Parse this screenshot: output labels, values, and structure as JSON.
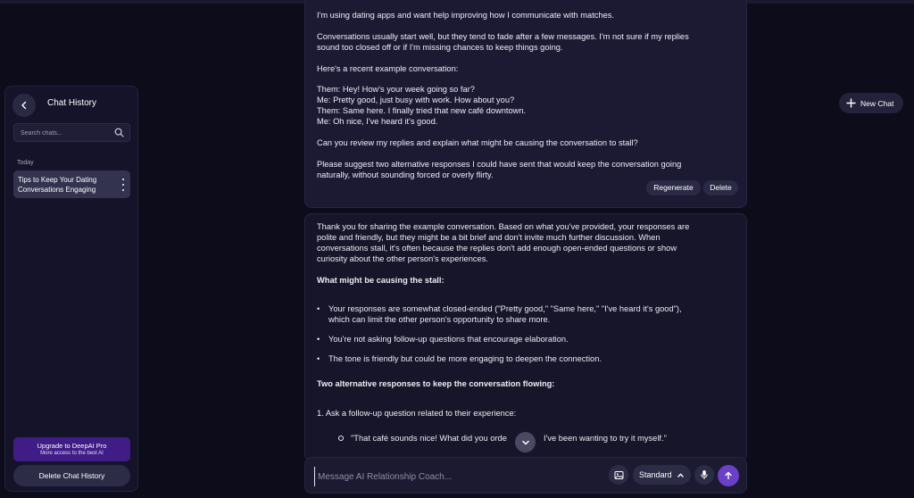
{
  "sidebar": {
    "title": "Chat History",
    "search_placeholder": "Search chats...",
    "group_label": "Today",
    "items": [
      {
        "label": "Tips to Keep Your Dating Conversations Engaging"
      }
    ],
    "upgrade_title": "Upgrade to DeepAI Pro",
    "upgrade_subtitle": "More access to the best AI",
    "delete_label": "Delete Chat History"
  },
  "header": {
    "new_chat_label": "New Chat"
  },
  "user_message": {
    "p1": "I'm using dating apps and want help improving how I communicate with matches.",
    "p2_l1": "Conversations usually start well, but they tend to fade after a few messages. I'm not sure if my replies",
    "p2_l2": "sound too closed off or if I'm missing chances to keep things going.",
    "p3": "Here's a recent example conversation:",
    "convo": [
      "Them: Hey! How's your week going so far?",
      "Me: Pretty good, just busy with work. How about you?",
      "Them: Same here. I finally tried that new café downtown.",
      "Me: Oh nice, I've heard it's good."
    ],
    "p4": "Can you review my replies and explain what might be causing the conversation to stall?",
    "p5_l1": "Please suggest two alternative responses I could have sent that would keep the conversation going",
    "p5_l2": "naturally, without sounding forced or overly flirty.",
    "regenerate_label": "Regenerate",
    "delete_label": "Delete"
  },
  "ai_message": {
    "intro": [
      "Thank you for sharing the example conversation. Based on what you've provided, your responses are",
      "polite and friendly, but they might be a bit brief and don't invite much further discussion. When",
      "conversations stall, it's often because the replies don't add enough open-ended questions or show",
      "curiosity about the other person's experiences."
    ],
    "heading1": "What might be causing the stall:",
    "bullets": [
      {
        "l1": "Your responses are somewhat closed-ended (\"Pretty good,\" \"Same here,\" \"I've heard it's good\"),",
        "l2": "which can limit the other person's opportunity to share more."
      },
      {
        "l1": "You're not asking follow-up questions that encourage elaboration.",
        "l2": ""
      },
      {
        "l1": "The tone is friendly but could be more engaging to deepen the connection.",
        "l2": ""
      }
    ],
    "heading2": "Two alternative responses to keep the conversation flowing:",
    "numbered1": "1. Ask a follow-up question related to their experience:",
    "quote_start": "\"That café sounds nice! What did you orde",
    "quote_end": "I've been wanting to try it myself.\""
  },
  "composer": {
    "placeholder": "Message AI Relationship Coach...",
    "model_label": "Standard"
  },
  "colors": {
    "background": "#0d0c1b",
    "panel": "#14132a",
    "accent": "#6b3fc6",
    "upgrade": "#3f1c86"
  },
  "icons": [
    "back-arrow-icon",
    "search-icon",
    "more-vertical-icon",
    "plus-icon",
    "chevron-down-icon",
    "image-icon",
    "chevron-up-icon",
    "microphone-icon",
    "send-arrow-icon"
  ]
}
